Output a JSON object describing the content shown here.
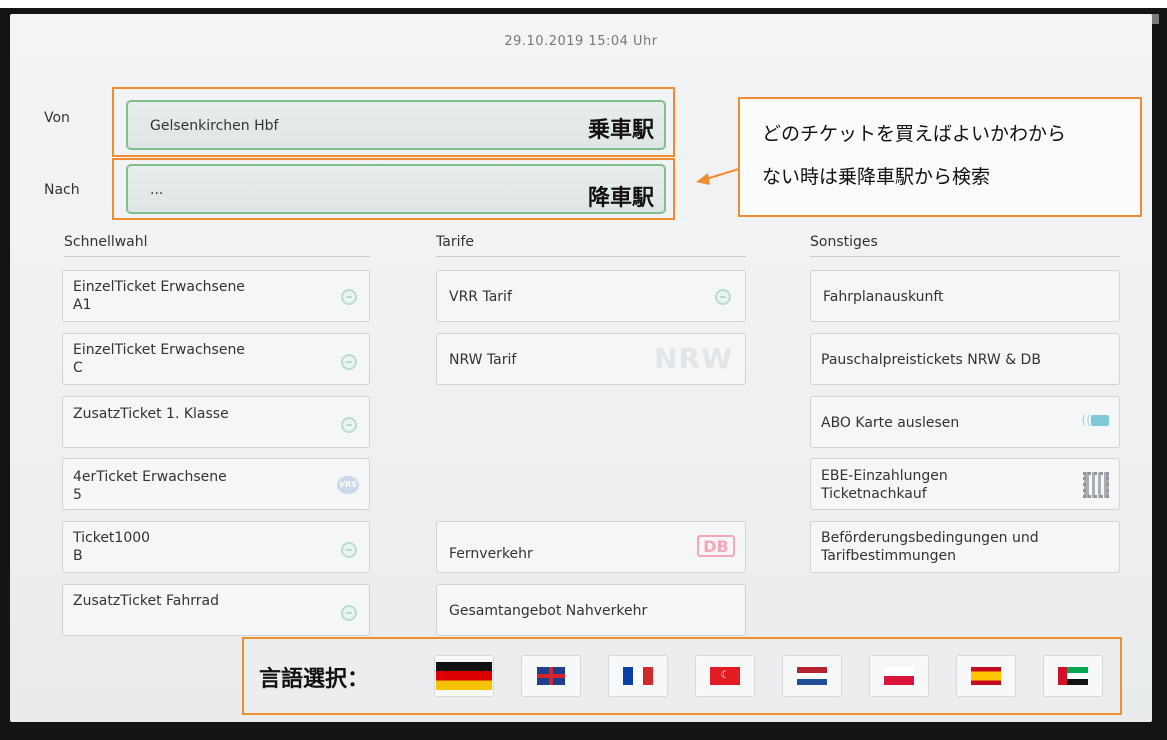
{
  "datetime": "29.10.2019  15:04  Uhr",
  "route": {
    "from_label": "Von",
    "from_value": "Gelsenkirchen Hbf",
    "to_label": "Nach",
    "to_value": "..."
  },
  "annotations": {
    "from_jp": "乗車駅",
    "to_jp": "降車駅",
    "hint_line1": "どのチケットを買えばよいかわから",
    "hint_line2": "ない時は乗降車駅から検索",
    "language_label": "言語選択："
  },
  "columns": {
    "schnellwahl": {
      "title": "Schnellwahl",
      "items": [
        {
          "line1": "EinzelTicket Erwachsene",
          "line2": "A1",
          "icon": "vrr-icon"
        },
        {
          "line1": "EinzelTicket Erwachsene",
          "line2": "C",
          "icon": "vrr-icon"
        },
        {
          "line1": "ZusatzTicket 1. Klasse",
          "line2": "",
          "icon": "vrr-icon"
        },
        {
          "line1": "4erTicket Erwachsene",
          "line2": "5",
          "icon": "vrs-icon"
        },
        {
          "line1": "Ticket1000",
          "line2": "B",
          "icon": "vrr-icon"
        },
        {
          "line1": "ZusatzTicket Fahrrad",
          "line2": "",
          "icon": "vrr-icon"
        }
      ]
    },
    "tarife": {
      "title": "Tarife",
      "items": [
        {
          "label": "VRR Tarif",
          "icon": "vrr-icon"
        },
        {
          "label": "NRW Tarif",
          "icon": "nrw-logo-icon",
          "logo_text": "NRW"
        },
        {
          "label": "Fernverkehr",
          "icon": "db-logo-icon",
          "logo_text": "DB"
        },
        {
          "label": "Gesamtangebot Nahverkehr",
          "icon": ""
        }
      ]
    },
    "sonstiges": {
      "title": "Sonstiges",
      "items": [
        {
          "line1": "Fahrplanauskunft",
          "line2": "",
          "icon": ""
        },
        {
          "line1": "Pauschalpreistickets NRW & DB",
          "line2": "",
          "icon": ""
        },
        {
          "line1": "ABO Karte auslesen",
          "line2": "",
          "icon": "nfc-card-icon"
        },
        {
          "line1": "EBE-Einzahlungen",
          "line2": "Ticketnachkauf",
          "icon": "qr-code-icon"
        },
        {
          "line1": "Beförderungsbedingungen und",
          "line2": "Tarifbestimmungen",
          "icon": ""
        }
      ]
    }
  },
  "languages": [
    "german-flag-icon",
    "uk-flag-icon",
    "france-flag-icon",
    "turkey-flag-icon",
    "netherlands-flag-icon",
    "poland-flag-icon",
    "spain-flag-icon",
    "uae-flag-icon"
  ],
  "colors": {
    "annotation_orange": "#f08c32",
    "field_border_green": "#7fc08a"
  }
}
